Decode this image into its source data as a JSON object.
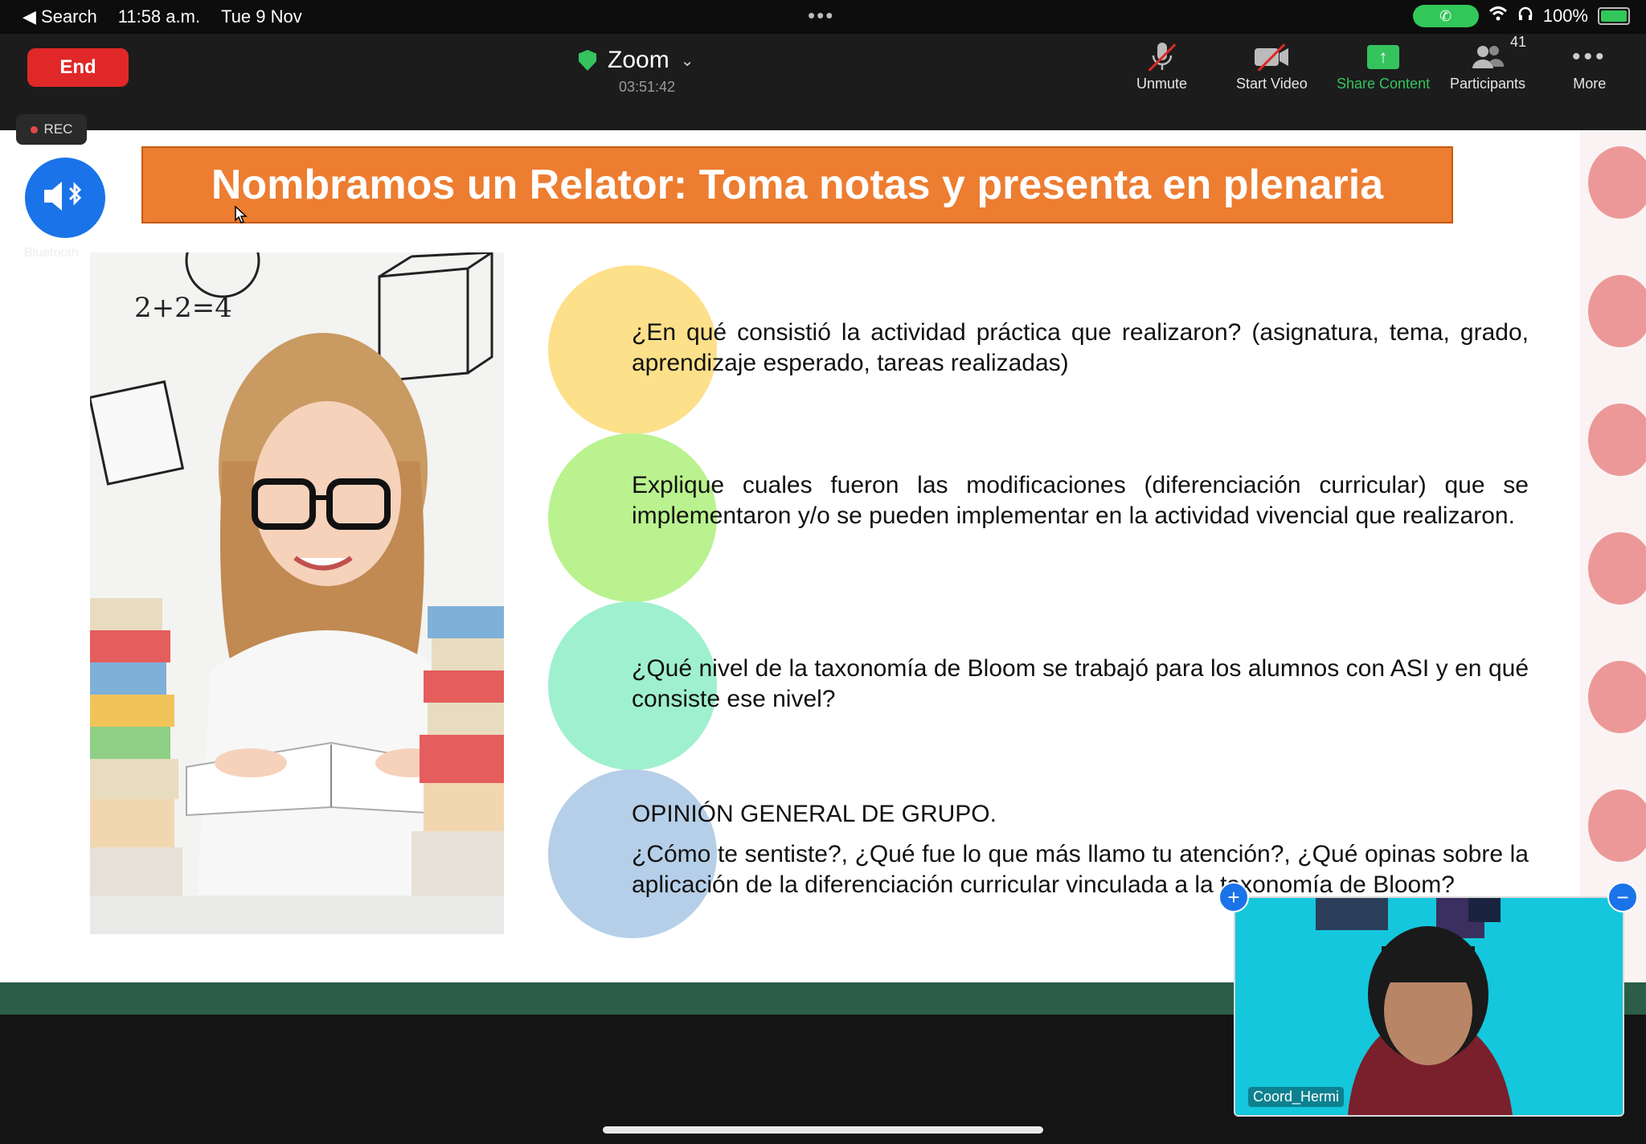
{
  "status_bar": {
    "back_label": "◀ Search",
    "time": "11:58 a.m.",
    "date": "Tue 9 Nov",
    "battery": "100%"
  },
  "toolbar": {
    "end_label": "End",
    "meeting_title": "Zoom",
    "elapsed": "03:51:42",
    "buttons": {
      "unmute": "Unmute",
      "start_video": "Start Video",
      "share_content": "Share Content",
      "participants": "Participants",
      "participants_count": "41",
      "more": "More"
    }
  },
  "rec_label": "REC",
  "bluetooth_label": "Bluetooth",
  "slide": {
    "title": "Nombramos un Relator: Toma notas y presenta en plenaria",
    "bubble_colors": [
      "#fde08a",
      "#b9f28e",
      "#9ff0cf",
      "#b6cfe8"
    ],
    "questions": [
      "¿En qué consistió la actividad práctica que realizaron? (asignatura, tema, grado, aprendizaje esperado, tareas realizadas)",
      "Explique cuales fueron las modificaciones (diferenciación curricular) que se implementaron y/o se pueden implementar en la actividad vivencial que realizaron.",
      "¿Qué nivel de la taxonomía de Bloom se trabajó para los alumnos con ASI y en qué consiste ese nivel?"
    ],
    "last_heading": "OPINIÓN GENERAL DE GRUPO.",
    "last_question": "¿Cómo te sentiste?, ¿Qué fue lo que más llamo tu atención?, ¿Qué opinas sobre la aplicación de la diferenciación curricular vinculada a la taxonomía de Bloom?",
    "photo_math": "2+2=4"
  },
  "self_view": {
    "name": "Coord_Hermi"
  }
}
